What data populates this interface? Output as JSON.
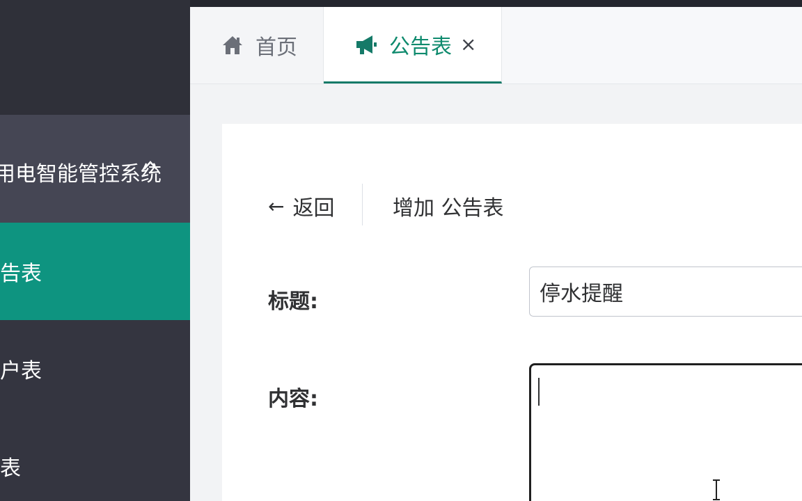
{
  "sidebar": {
    "group": {
      "label": "用电智能管控系统",
      "icon": "chevron-up-icon"
    },
    "items": [
      {
        "label": "公告表",
        "active": true
      },
      {
        "label": "用户表",
        "active": false
      },
      {
        "label": "电表",
        "active": false
      }
    ],
    "accent_color": "#0e9480"
  },
  "tabs": [
    {
      "label": "首页",
      "icon": "home-icon",
      "active": false
    },
    {
      "label": "公告表",
      "icon": "megaphone-icon",
      "active": true,
      "closable": true,
      "close_glyph": "×"
    }
  ],
  "page": {
    "back_label": "返回",
    "back_arrow": "←",
    "title": "增加 公告表"
  },
  "form": {
    "title_label": "标题:",
    "title_value": "停水提醒",
    "content_label": "内容:",
    "content_value": ""
  }
}
